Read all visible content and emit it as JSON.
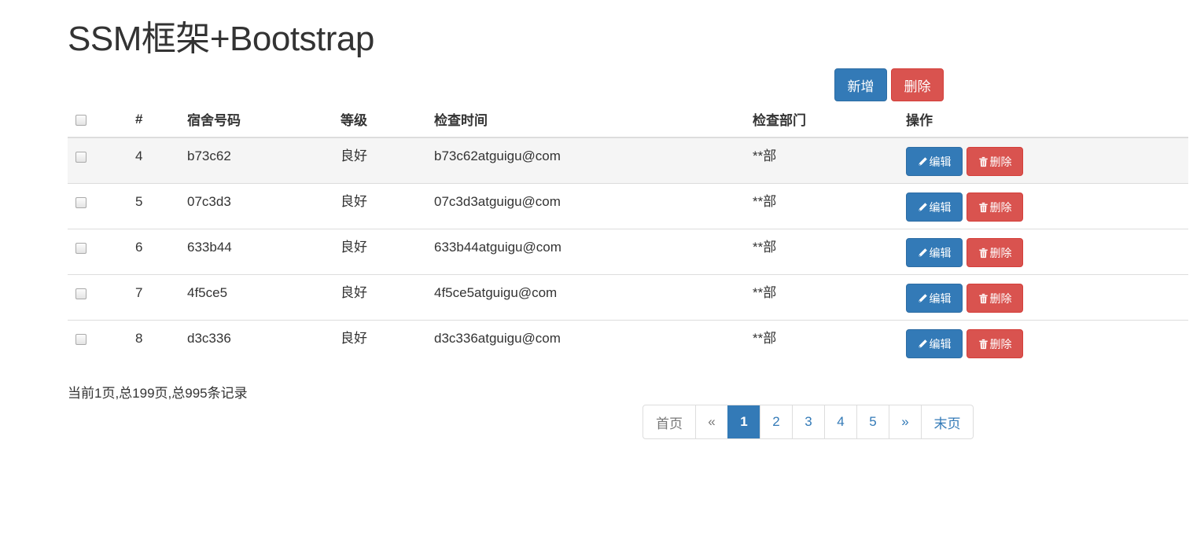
{
  "header": {
    "title": "SSM框架+Bootstrap"
  },
  "toolbar": {
    "add_label": "新增",
    "delete_label": "删除"
  },
  "table": {
    "columns": [
      "#",
      "宿舍号码",
      "等级",
      "检查时间",
      "检查部门",
      "操作"
    ],
    "rows": [
      {
        "id": "4",
        "room": "b73c62",
        "grade": "良好",
        "time": "b73c62atguigu@com",
        "dept": "**部"
      },
      {
        "id": "5",
        "room": "07c3d3",
        "grade": "良好",
        "time": "07c3d3atguigu@com",
        "dept": "**部"
      },
      {
        "id": "6",
        "room": "633b44",
        "grade": "良好",
        "time": "633b44atguigu@com",
        "dept": "**部"
      },
      {
        "id": "7",
        "room": "4f5ce5",
        "grade": "良好",
        "time": "4f5ce5atguigu@com",
        "dept": "**部"
      },
      {
        "id": "8",
        "room": "d3c336",
        "grade": "良好",
        "time": "d3c336atguigu@com",
        "dept": "**部"
      }
    ],
    "edit_label": "编辑",
    "row_delete_label": "删除",
    "edit_icon": "pencil-icon",
    "delete_icon": "trash-icon"
  },
  "footer": {
    "page_info": "当前1页,总199页,总995条记录",
    "pagination": {
      "first": "首页",
      "prev": "«",
      "pages": [
        "1",
        "2",
        "3",
        "4",
        "5"
      ],
      "next": "»",
      "last": "末页",
      "active_page": "1"
    }
  },
  "colors": {
    "primary": "#337ab7",
    "danger": "#d9534f",
    "text": "#333333",
    "stripe": "#f5f5f5"
  }
}
